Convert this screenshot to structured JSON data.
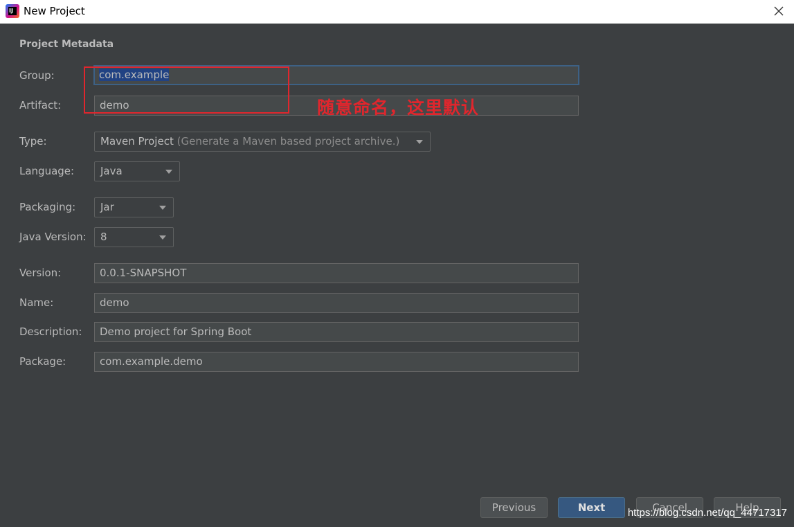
{
  "window": {
    "title": "New Project"
  },
  "section": {
    "title": "Project Metadata"
  },
  "form": {
    "group": {
      "label": "Group:",
      "value": "com.example"
    },
    "artifact": {
      "label": "Artifact:",
      "value": "demo"
    },
    "type": {
      "label": "Type:",
      "value": "Maven Project",
      "hint": " (Generate a Maven based project archive.)"
    },
    "language": {
      "label": "Language:",
      "value": "Java"
    },
    "packaging": {
      "label": "Packaging:",
      "value": "Jar"
    },
    "java_version": {
      "label": "Java Version:",
      "value": "8"
    },
    "version": {
      "label": "Version:",
      "value": "0.0.1-SNAPSHOT"
    },
    "name": {
      "label": "Name:",
      "value": "demo"
    },
    "description": {
      "label": "Description:",
      "value": "Demo project for Spring Boot"
    },
    "package": {
      "label": "Package:",
      "value": "com.example.demo"
    }
  },
  "annotation": {
    "text": "随意命名，这里默认",
    "color": "#e0262d"
  },
  "buttons": {
    "previous": "Previous",
    "next": "Next",
    "cancel": "Cancel",
    "help": "Help"
  },
  "watermark": "https://blog.csdn.net/qq_44717317",
  "colors": {
    "background": "#3c3f41",
    "accent": "#365880",
    "focus": "#3d6185"
  }
}
